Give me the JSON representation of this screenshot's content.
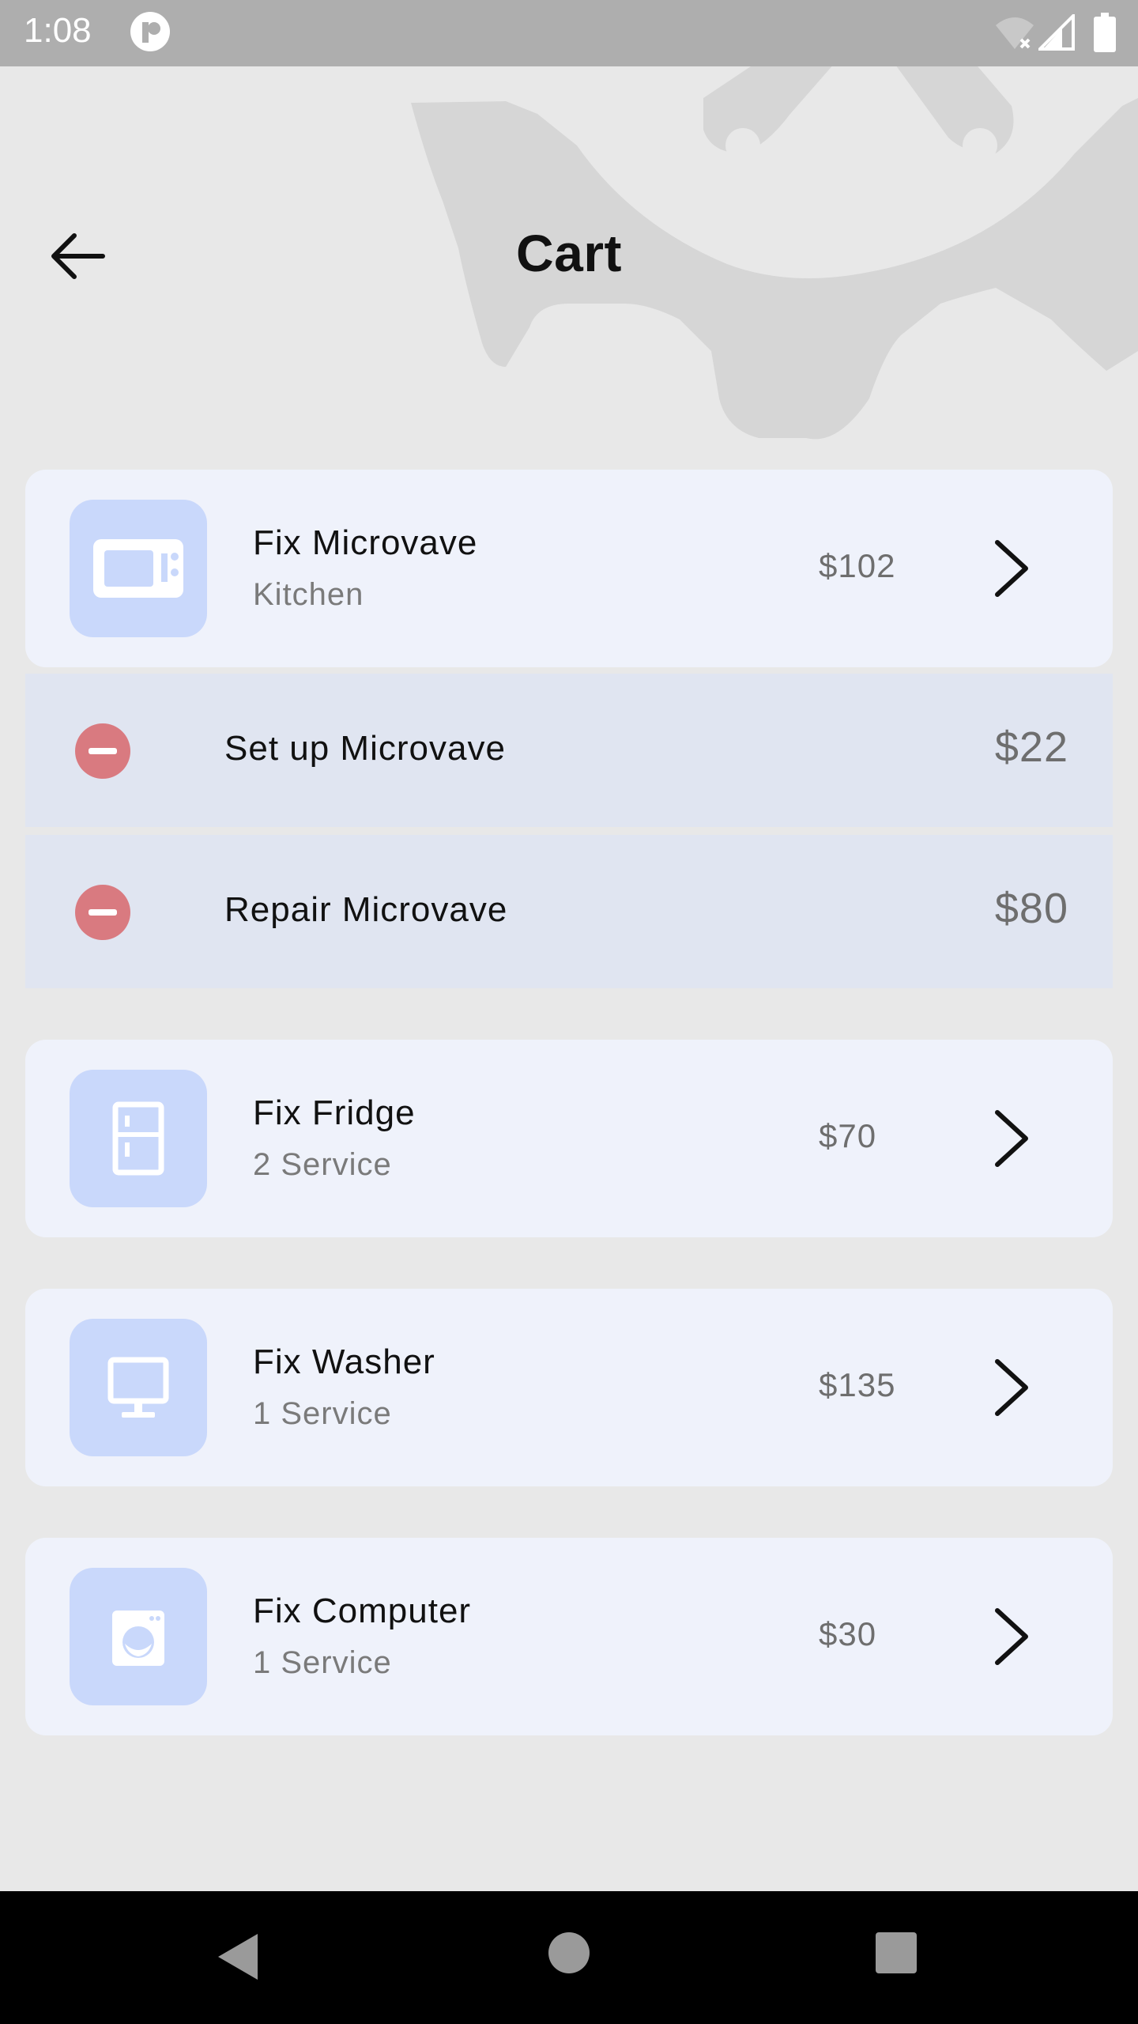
{
  "status_bar": {
    "time": "1:08"
  },
  "header": {
    "title": "Cart"
  },
  "cards": [
    {
      "title": "Fix Microvave",
      "subtitle": "Kitchen",
      "price": "$102",
      "icon": "microwave-icon"
    },
    {
      "title": "Fix Fridge",
      "subtitle": "2 Service",
      "price": "$70",
      "icon": "fridge-icon"
    },
    {
      "title": "Fix Washer",
      "subtitle": "1 Service",
      "price": "$135",
      "icon": "monitor-icon"
    },
    {
      "title": "Fix Computer",
      "subtitle": "1 Service",
      "price": "$30",
      "icon": "washer-icon"
    }
  ],
  "sub_services": [
    {
      "label": "Set up Microvave",
      "price": "$22"
    },
    {
      "label": "Repair Microvave",
      "price": "$80"
    }
  ],
  "colors": {
    "card_bg": "#eff2fb",
    "icon_tile": "#c9d8fb",
    "sub_row_bg": "#e0e5f1",
    "remove_red": "#d97a80",
    "page_bg": "#e8e8e8"
  }
}
